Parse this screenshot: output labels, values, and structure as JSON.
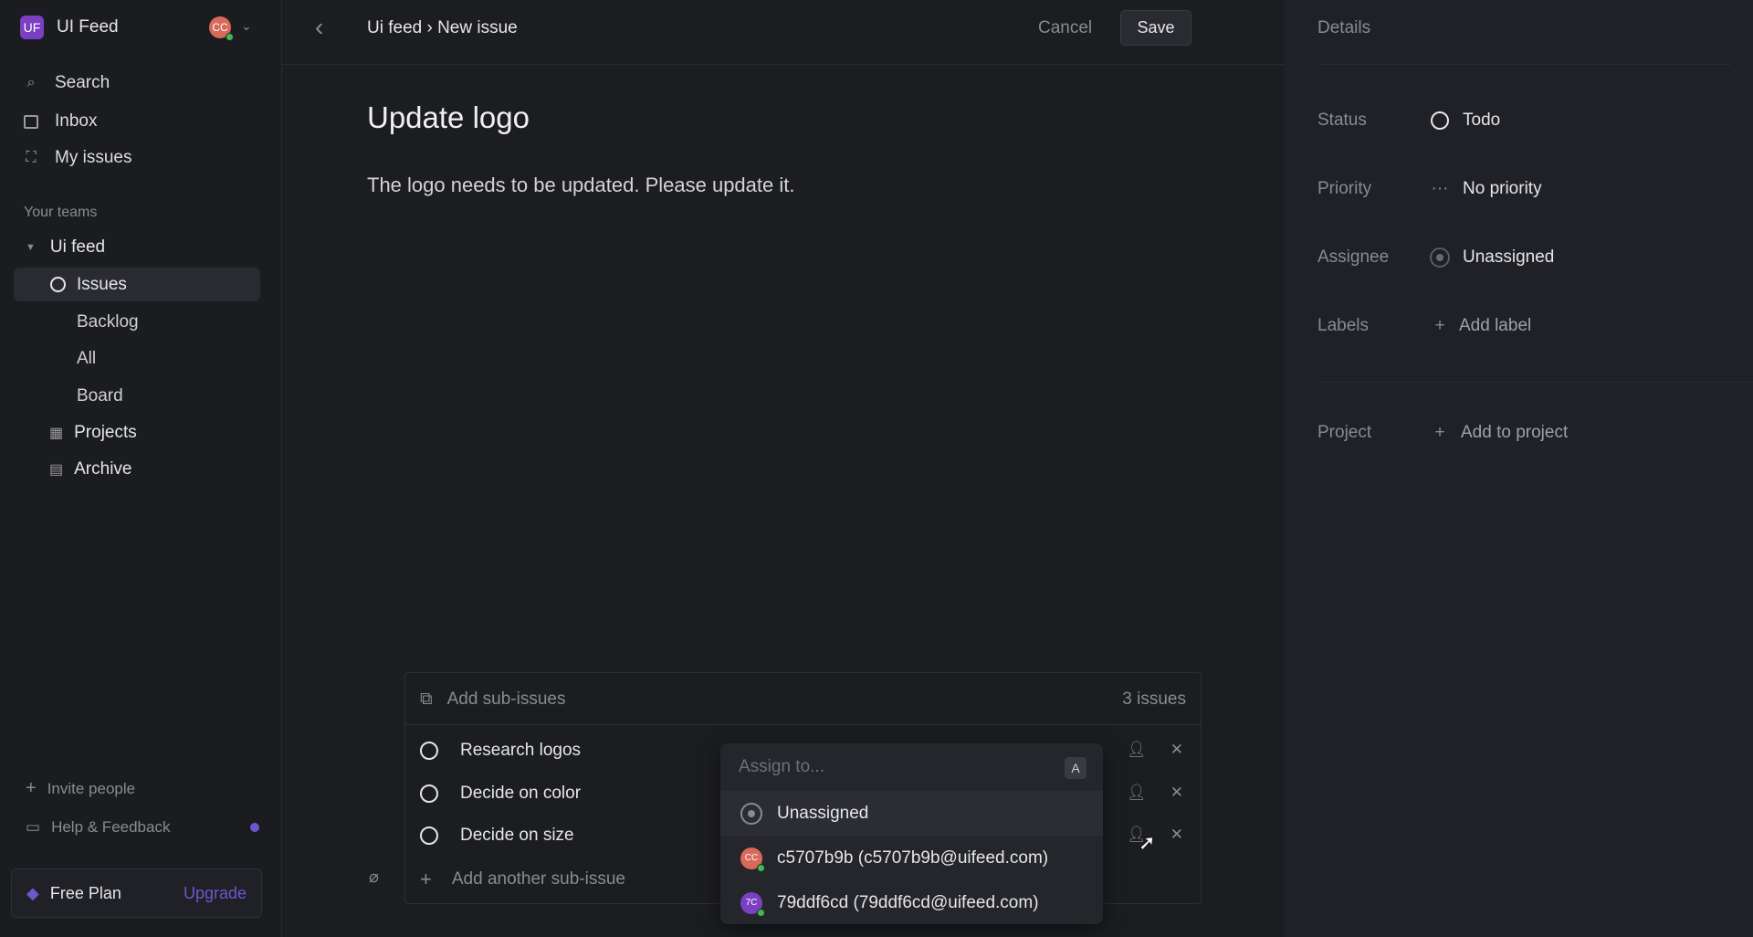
{
  "workspace": {
    "initials": "UF",
    "name": "UI Feed",
    "user_initials": "CC"
  },
  "sidebar": {
    "items": [
      {
        "label": "Search",
        "icon": "search-icon"
      },
      {
        "label": "Inbox",
        "icon": "inbox-icon"
      },
      {
        "label": "My issues",
        "icon": "my-issues-icon"
      }
    ],
    "teams_heading": "Your teams",
    "team": {
      "name": "Ui feed",
      "items": [
        {
          "label": "Issues"
        },
        {
          "label": "Backlog"
        },
        {
          "label": "All"
        },
        {
          "label": "Board"
        },
        {
          "label": "Projects"
        },
        {
          "label": "Archive"
        }
      ]
    },
    "invite": "Invite people",
    "help": "Help & Feedback",
    "plan": "Free Plan",
    "upgrade": "Upgrade"
  },
  "header": {
    "breadcrumb": "Ui feed › New issue",
    "cancel": "Cancel",
    "save": "Save"
  },
  "issue": {
    "title": "Update logo",
    "description": "The logo needs to be updated. Please update it."
  },
  "subissues": {
    "header": "Add sub-issues",
    "count": "3 issues",
    "items": [
      "Research logos",
      "Decide on color",
      "Decide on size"
    ],
    "add_another": "Add another sub-issue"
  },
  "assign_dropdown": {
    "placeholder": "Assign to...",
    "shortcut": "A",
    "options": [
      {
        "label": "Unassigned"
      },
      {
        "label": "c5707b9b (c5707b9b@uifeed.com)",
        "initials": "CC",
        "color": "#d9695a"
      },
      {
        "label": "79ddf6cd (79ddf6cd@uifeed.com)",
        "initials": "7C",
        "color": "#7b3fc2"
      }
    ]
  },
  "details": {
    "heading": "Details",
    "status": {
      "label": "Status",
      "value": "Todo"
    },
    "priority": {
      "label": "Priority",
      "value": "No priority"
    },
    "assignee": {
      "label": "Assignee",
      "value": "Unassigned"
    },
    "labels": {
      "label": "Labels",
      "value": "Add label"
    },
    "project": {
      "label": "Project",
      "value": "Add to project"
    }
  },
  "colors": {
    "accent": "#6e56cf",
    "brand": "#7b3fc2",
    "online": "#3fb950"
  }
}
